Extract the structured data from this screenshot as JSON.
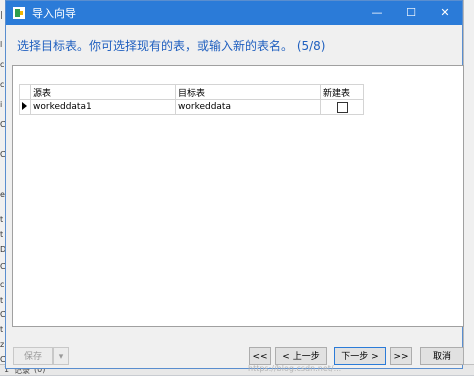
{
  "window": {
    "title": "导入向导",
    "controls": {
      "minimize": "—",
      "maximize": "☐",
      "close": "✕"
    }
  },
  "heading": "选择目标表。你可选择现有的表，或输入新的表名。 (5/8)",
  "table": {
    "headers": {
      "source": "源表",
      "target": "目标表",
      "new_table": "新建表"
    },
    "rows": [
      {
        "source": "workeddata1",
        "target": "workeddata",
        "new_table_checked": false
      }
    ]
  },
  "footer": {
    "save": "保存",
    "save_dropdown": "▾",
    "first": "<<",
    "prev": "< 上一步",
    "next": "下一步 >",
    "last": ">>",
    "cancel": "取消"
  },
  "watermark": "https://blog.csdn.net/...",
  "background": {
    "left_fragments": [
      "|",
      "l",
      "c",
      "c",
      "i",
      "C",
      "C",
      "e",
      "t",
      "t",
      "D",
      "C",
      "c",
      "t",
      "C",
      "t",
      "z",
      "C"
    ],
    "bottom_fragments": [
      "1",
      "记录",
      "(0)"
    ]
  },
  "colors": {
    "titlebar": "#2b7bd8",
    "heading": "#1f5fbf",
    "dialog_bg": "#f0f0f0"
  }
}
